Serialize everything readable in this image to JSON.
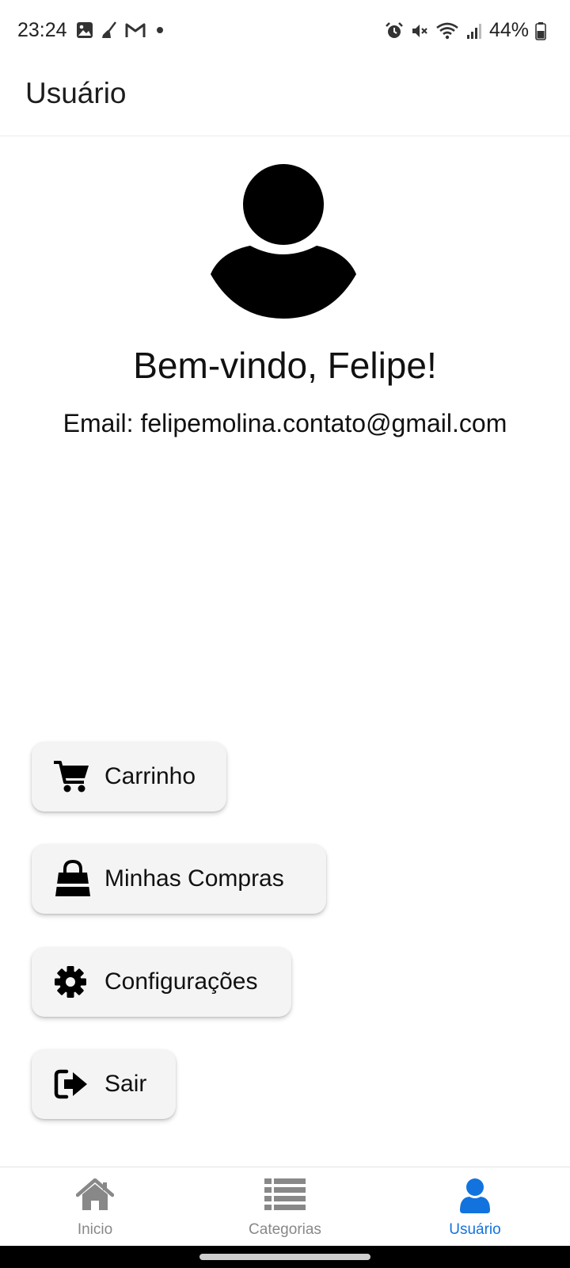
{
  "status_bar": {
    "time": "23:24",
    "battery_percent": "44%",
    "left_icons": [
      "image-icon",
      "broom-icon",
      "gmail-icon",
      "dot-icon"
    ],
    "right_icons": [
      "alarm-icon",
      "mute-icon",
      "wifi-icon",
      "signal-icon",
      "battery-icon"
    ]
  },
  "app_bar": {
    "title": "Usuário"
  },
  "profile": {
    "avatar_icon": "user-avatar-icon",
    "welcome": "Bem-vindo, Felipe!",
    "email": "Email: felipemolina.contato@gmail.com"
  },
  "menu": {
    "cart": {
      "label": "Carrinho",
      "icon": "cart-icon"
    },
    "orders": {
      "label": "Minhas Compras",
      "icon": "shopping-bag-icon"
    },
    "settings": {
      "label": "Configurações",
      "icon": "gear-icon"
    },
    "logout": {
      "label": "Sair",
      "icon": "sign-out-icon"
    }
  },
  "bottom_nav": {
    "active_color": "#1273de",
    "inactive_color": "#888888",
    "items": [
      {
        "label": "Inicio",
        "icon": "home-icon",
        "active": false
      },
      {
        "label": "Categorias",
        "icon": "list-icon",
        "active": false
      },
      {
        "label": "Usuário",
        "icon": "user-icon",
        "active": true
      }
    ]
  }
}
